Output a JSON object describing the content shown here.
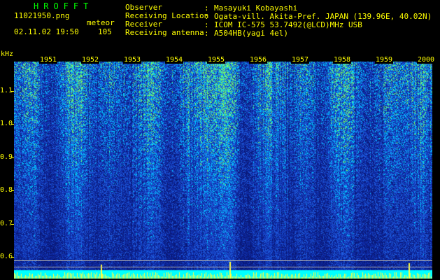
{
  "header": {
    "title": "HROFFT",
    "filename": "11021950.png",
    "datetime": "02.11.02 19:50",
    "meteor_label": "meteor",
    "meteor_count": "105"
  },
  "info": [
    {
      "label": "Observer",
      "value": "Masayuki Kobayashi"
    },
    {
      "label": "Receiving Location",
      "value": "Ogata-vill. Akita-Pref. JAPAN (139.96E, 40.02N)"
    },
    {
      "label": "Receiver",
      "value": "ICOM IC-575 53.7492(@LCD)MHz USB"
    },
    {
      "label": "Receiving antenna",
      "value": "A504HB(yagi 4el)"
    }
  ],
  "spectrogram": {
    "y_unit": "kHz",
    "y_ticks": [
      "1.1",
      "1.0",
      "0.9",
      "0.8",
      "0.7",
      "0.6"
    ],
    "y_values": [
      1.1,
      1.0,
      0.9,
      0.8,
      0.7,
      0.6
    ],
    "y_range": [
      0.56,
      1.18
    ],
    "time_labels": [
      "1951",
      "1952",
      "1953",
      "1954",
      "1955",
      "1956",
      "1957",
      "1958",
      "1959",
      "2000"
    ],
    "colors": {
      "background": "#000000",
      "noise_dark": "#0a1e8c",
      "noise_mid": "#1e5adc",
      "noise_bright": "#00d2ff",
      "highlight": "#7cff64",
      "text": "#ffff00",
      "title": "#00ff00"
    }
  }
}
